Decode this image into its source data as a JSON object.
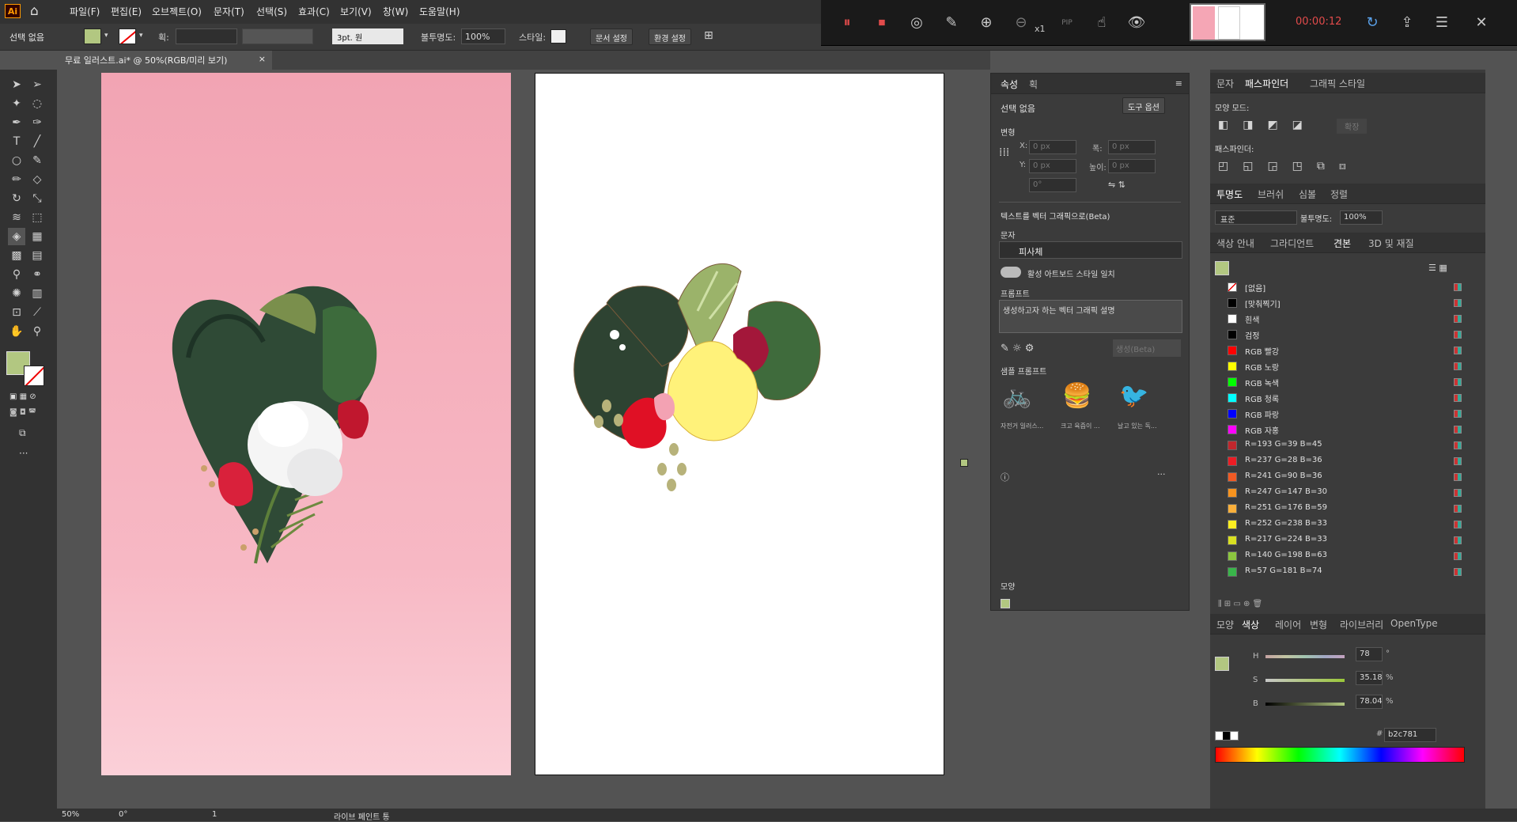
{
  "app": {
    "logo": "Ai",
    "home_icon": "home-icon"
  },
  "menu": [
    "파일(F)",
    "편집(E)",
    "오브젝트(O)",
    "문자(T)",
    "선택(S)",
    "효과(C)",
    "보기(V)",
    "창(W)",
    "도움말(H)"
  ],
  "control": {
    "selection": "선택 없음",
    "stroke_label": "획:",
    "brush": "3pt. 원",
    "opacity_label": "불투명도:",
    "opacity": "100%",
    "style_label": "스타일:",
    "doc_setup": "문서 설정",
    "preferences": "환경 설정"
  },
  "recorder": {
    "timer": "00:00:12",
    "zoom": "x1",
    "pip": "PIP"
  },
  "doc_tab": {
    "title": "무료 일러스트.ai* @ 50%(RGB/미리 보기)",
    "close": "×"
  },
  "properties": {
    "tabs": [
      "속성",
      "획"
    ],
    "selection": "선택 없음",
    "tool_options": "도구 옵션",
    "transform": "변형",
    "x": "X:",
    "y": "Y:",
    "w": "폭:",
    "h": "높이:",
    "px0": "0 px",
    "angle": "0°",
    "t2v_title": "텍스트를 벡터 그래픽으로(Beta)",
    "type_label": "문자",
    "type_value": "피사체",
    "match_style": "활성 아트보드 스타일 일치",
    "prompt_label": "프롬프트",
    "prompt_placeholder": "생성하고자 하는 벡터 그래픽 설명",
    "generate": "생성(Beta)",
    "samples_label": "샘플 프롬프트",
    "samples": [
      "자전거 일러스...",
      "크고 육즙이 ...",
      "날고 있는 독..."
    ],
    "appearance": "모양"
  },
  "pathfinder": {
    "tabs": [
      "문자",
      "패스파인더",
      "그래픽 스타일"
    ],
    "shape_modes": "모양 모드:",
    "expand": "확장",
    "pathfinders": "패스파인더:"
  },
  "transparency": {
    "tabs": [
      "투명도",
      "브러쉬",
      "심볼",
      "정렬"
    ],
    "mode": "표준",
    "opacity_label": "불투명도:",
    "opacity": "100%"
  },
  "swatches": {
    "tabs": [
      "색상 안내",
      "그라디언트",
      "견본",
      "3D 및 재질"
    ],
    "items": [
      {
        "name": "[없음]",
        "color": "none"
      },
      {
        "name": "[맞춰찍기]",
        "color": "#000000"
      },
      {
        "name": "흰색",
        "color": "#ffffff"
      },
      {
        "name": "검정",
        "color": "#000000"
      },
      {
        "name": "RGB 빨강",
        "color": "#ff0000"
      },
      {
        "name": "RGB 노랑",
        "color": "#ffff00"
      },
      {
        "name": "RGB 녹색",
        "color": "#00ff00"
      },
      {
        "name": "RGB 청록",
        "color": "#00ffff"
      },
      {
        "name": "RGB 파랑",
        "color": "#0000ff"
      },
      {
        "name": "RGB 자홍",
        "color": "#ff00ff"
      },
      {
        "name": "R=193 G=39 B=45",
        "color": "#c1272d"
      },
      {
        "name": "R=237 G=28 B=36",
        "color": "#ed1c24"
      },
      {
        "name": "R=241 G=90 B=36",
        "color": "#f15a24"
      },
      {
        "name": "R=247 G=147 B=30",
        "color": "#f7931e"
      },
      {
        "name": "R=251 G=176 B=59",
        "color": "#fbb03b"
      },
      {
        "name": "R=252 G=238 B=33",
        "color": "#fcee21"
      },
      {
        "name": "R=217 G=224 B=33",
        "color": "#d9e021"
      },
      {
        "name": "R=140 G=198 B=63",
        "color": "#8cc63f"
      },
      {
        "name": "R=57 G=181 B=74",
        "color": "#39b54a"
      }
    ]
  },
  "color": {
    "tabs": [
      "모양",
      "색상",
      "레이어",
      "변형",
      "라이브러리",
      "OpenType"
    ],
    "h_label": "H",
    "h": "78",
    "s_label": "S",
    "s": "35.18",
    "b_label": "B",
    "b": "78.04",
    "hex": "b2c781",
    "deg": "°",
    "pct": "%",
    "fill": "#b2c781"
  },
  "status": {
    "zoom": "50%",
    "angle": "0°",
    "page": "1",
    "tool": "라이브 페인트 통"
  }
}
